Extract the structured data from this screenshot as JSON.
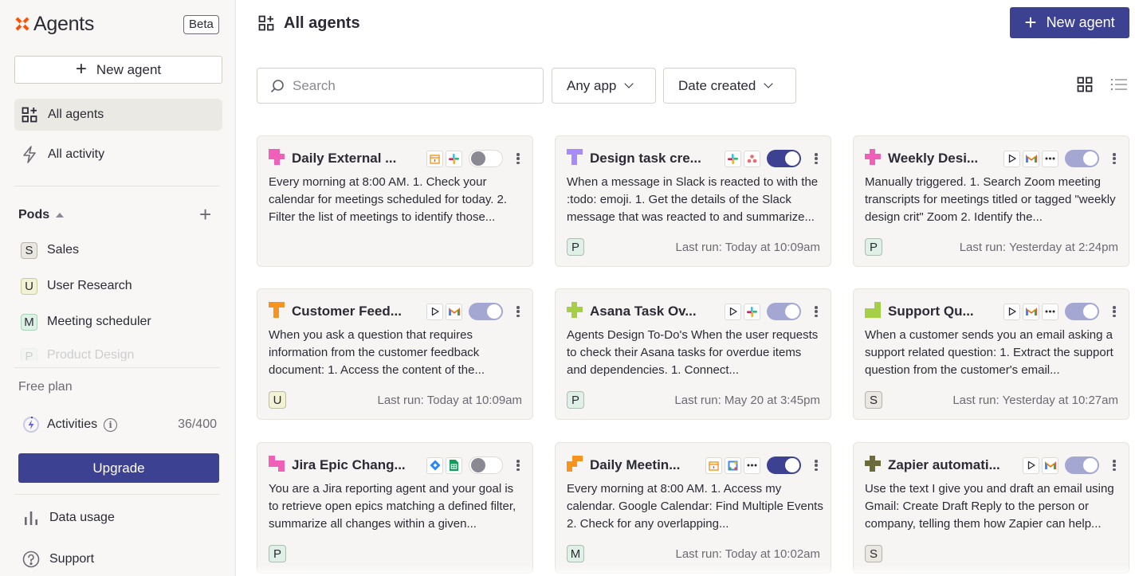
{
  "app": {
    "name": "Agents",
    "badge": "Beta"
  },
  "sidebar": {
    "new_agent": "New agent",
    "nav": [
      {
        "label": "All agents",
        "icon": "grid-icon",
        "active": true
      },
      {
        "label": "All activity",
        "icon": "lightning-icon",
        "active": false
      }
    ],
    "pods_title": "Pods",
    "pods": [
      {
        "letter": "S",
        "label": "Sales",
        "color": "#e9e7df"
      },
      {
        "letter": "U",
        "label": "User Research",
        "color": "#f1f3d4"
      },
      {
        "letter": "M",
        "label": "Meeting scheduler",
        "color": "#dff1e6"
      },
      {
        "letter": "P",
        "label": "Product Design",
        "color": "#dff1e6"
      }
    ],
    "plan": "Free plan",
    "activities_label": "Activities",
    "activities_count": "36/400",
    "upgrade": "Upgrade",
    "data_usage": "Data usage",
    "support": "Support"
  },
  "main": {
    "title": "All agents",
    "new_agent": "New agent",
    "search_placeholder": "Search",
    "filters": [
      "Any app",
      "Date created"
    ],
    "colors": {
      "primary": "#3d4192"
    }
  },
  "cards": [
    {
      "title": "Daily External ...",
      "icon_color": "#f060b8",
      "apps": [
        "calendar-icon",
        "slack-icon"
      ],
      "toggle": "off",
      "desc": "Every morning at 8:00 AM. 1. Check your calendar for meetings scheduled for today. 2. Filter the list of meetings to identify those...",
      "pod": "",
      "pod_color": "",
      "last_run": ""
    },
    {
      "title": "Design task cre...",
      "icon_color": "#a78bfa",
      "apps": [
        "slack-icon",
        "asana-icon"
      ],
      "toggle": "on",
      "desc": "When a message in Slack is reacted to with the :todo: emoji. 1. Get the details of the Slack message that was reacted to and summarize...",
      "pod": "P",
      "pod_color": "#dff1e6",
      "last_run": "Last run: Today at 10:09am"
    },
    {
      "title": "Weekly Desi...",
      "icon_color": "#f060b8",
      "apps": [
        "play-icon",
        "gmail-icon",
        "more-icon"
      ],
      "toggle": "half",
      "desc": "Manually triggered. 1. Search Zoom meeting transcripts for meetings titled or tagged \"weekly design crit\" Zoom 2. Identify the...",
      "pod": "P",
      "pod_color": "#dff1e6",
      "last_run": "Last run: Yesterday at 2:24pm"
    },
    {
      "title": "Customer Feed...",
      "icon_color": "#f7941d",
      "apps": [
        "play-icon",
        "gmail-icon"
      ],
      "toggle": "half",
      "desc": "When you ask a question that requires information from the customer feedback document: 1. Access the content of the...",
      "pod": "U",
      "pod_color": "#f1f3d4",
      "last_run": "Last run: Today at 10:09am"
    },
    {
      "title": "Asana Task Ov...",
      "icon_color": "#a6cf48",
      "apps": [
        "play-icon",
        "slack-icon"
      ],
      "toggle": "half",
      "desc": "Agents Design To-Do's When the user requests to check their Asana tasks for overdue items and dependencies. 1. Connect...",
      "pod": "P",
      "pod_color": "#dff1e6",
      "last_run": "Last run: May 20 at 3:45pm"
    },
    {
      "title": "Support Qu...",
      "icon_color": "#a6cf48",
      "apps": [
        "play-icon",
        "gmail-icon",
        "more-icon"
      ],
      "toggle": "half",
      "desc": "When a customer sends you an email asking a support related question: 1. Extract the support question from the customer's email...",
      "pod": "S",
      "pod_color": "#e9e7df",
      "last_run": "Last run: Yesterday at 10:27am"
    },
    {
      "title": "Jira Epic Chang...",
      "icon_color": "#f060b8",
      "apps": [
        "jira-icon",
        "sheets-icon"
      ],
      "toggle": "off",
      "desc": "You are a Jira reporting agent and your goal is to retrieve open epics matching a defined filter, summarize all changes within a given...",
      "pod": "P",
      "pod_color": "#dff1e6",
      "last_run": ""
    },
    {
      "title": "Daily Meetin...",
      "icon_color": "#f7941d",
      "apps": [
        "calendar-icon",
        "gcal-icon",
        "more-icon"
      ],
      "toggle": "on",
      "desc": "Every morning at 8:00 AM. 1. Access my calendar. Google Calendar: Find Multiple Events 2. Check for any overlapping...",
      "pod": "M",
      "pod_color": "#dff1e6",
      "last_run": "Last run: Today at 10:02am"
    },
    {
      "title": "Zapier automati...",
      "icon_color": "#6b6b3c",
      "apps": [
        "play-icon",
        "gmail-icon"
      ],
      "toggle": "half",
      "desc": "Use the text I give you and draft an email using Gmail: Create Draft Reply to the person or company, telling them how Zapier can help...",
      "pod": "S",
      "pod_color": "#e9e7df",
      "last_run": ""
    }
  ]
}
